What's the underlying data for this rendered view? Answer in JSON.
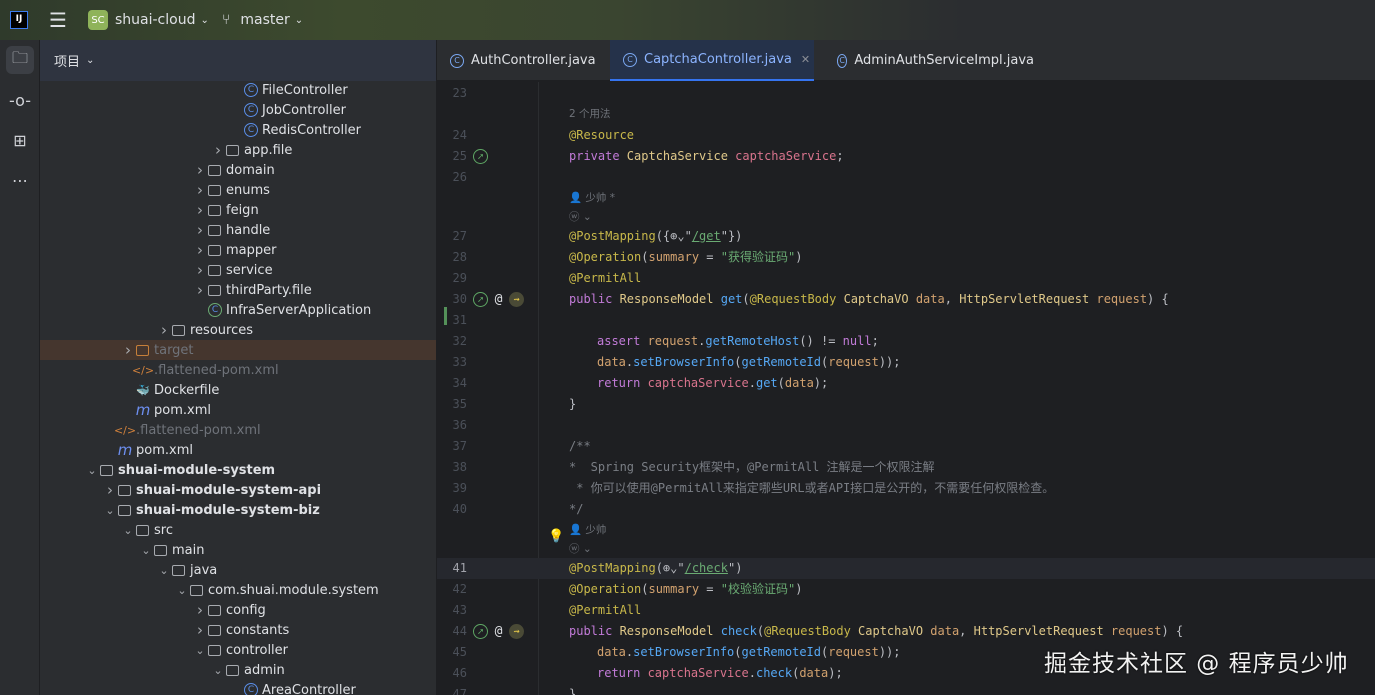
{
  "titlebar": {
    "logo": "IJ",
    "project_badge": "SC",
    "project_name": "shuai-cloud",
    "branch": "master",
    "brand_color": "#8fb35a"
  },
  "sidebar_tools": [
    {
      "icon": "folder-icon",
      "active": true
    },
    {
      "icon": "commit-icon"
    },
    {
      "icon": "structure-icon"
    },
    {
      "icon": "more-icon"
    }
  ],
  "project_panel": {
    "title": "项目",
    "items": [
      {
        "label": "FileController",
        "depth": 7,
        "type": "class"
      },
      {
        "label": "JobController",
        "depth": 7,
        "type": "class"
      },
      {
        "label": "RedisController",
        "depth": 7,
        "type": "class"
      },
      {
        "label": "app.file",
        "depth": 6,
        "type": "folder",
        "expanded": false
      },
      {
        "label": "domain",
        "depth": 5,
        "type": "folder",
        "expanded": false
      },
      {
        "label": "enums",
        "depth": 5,
        "type": "folder",
        "expanded": false
      },
      {
        "label": "feign",
        "depth": 5,
        "type": "folder",
        "expanded": false
      },
      {
        "label": "handle",
        "depth": 5,
        "type": "folder",
        "expanded": false
      },
      {
        "label": "mapper",
        "depth": 5,
        "type": "folder",
        "expanded": false
      },
      {
        "label": "service",
        "depth": 5,
        "type": "folder",
        "expanded": false
      },
      {
        "label": "thirdParty.file",
        "depth": 5,
        "type": "folder",
        "expanded": false
      },
      {
        "label": "InfraServerApplication",
        "depth": 5,
        "type": "spring"
      },
      {
        "label": "resources",
        "depth": 3,
        "type": "folder",
        "expanded": false
      },
      {
        "label": "target",
        "depth": 1,
        "type": "folder-excluded",
        "expanded": false,
        "muted": true,
        "selected": true
      },
      {
        "label": ".flattened-pom.xml",
        "depth": 1,
        "type": "xml",
        "muted": true
      },
      {
        "label": "Dockerfile",
        "depth": 1,
        "type": "docker"
      },
      {
        "label": "pom.xml",
        "depth": 1,
        "type": "maven"
      },
      {
        "label": ".flattened-pom.xml",
        "depth": 0,
        "type": "xml",
        "muted": true
      },
      {
        "label": "pom.xml",
        "depth": 0,
        "type": "maven"
      },
      {
        "label": "shuai-module-system",
        "depth": -1,
        "type": "module",
        "expanded": true,
        "bold": true
      },
      {
        "label": "shuai-module-system-api",
        "depth": 0,
        "type": "module",
        "expanded": false,
        "bold": true
      },
      {
        "label": "shuai-module-system-biz",
        "depth": 0,
        "type": "module",
        "expanded": true,
        "bold": true
      },
      {
        "label": "src",
        "depth": 1,
        "type": "folder",
        "expanded": true
      },
      {
        "label": "main",
        "depth": 2,
        "type": "folder",
        "expanded": true
      },
      {
        "label": "java",
        "depth": 3,
        "type": "folder",
        "expanded": true
      },
      {
        "label": "com.shuai.module.system",
        "depth": 4,
        "type": "folder",
        "expanded": true
      },
      {
        "label": "config",
        "depth": 5,
        "type": "folder",
        "expanded": false
      },
      {
        "label": "constants",
        "depth": 5,
        "type": "folder",
        "expanded": false
      },
      {
        "label": "controller",
        "depth": 5,
        "type": "folder",
        "expanded": true
      },
      {
        "label": "admin",
        "depth": 6,
        "type": "folder",
        "expanded": true
      },
      {
        "label": "AreaController",
        "depth": 7,
        "type": "class"
      }
    ]
  },
  "tabs": [
    {
      "label": "AuthController.java"
    },
    {
      "label": "CaptchaController.java",
      "active": true
    },
    {
      "label": "AdminAuthServiceImpl.java"
    }
  ],
  "editor": {
    "rows": [
      {
        "n": "23",
        "t": []
      },
      {
        "hint": "2 个用法"
      },
      {
        "n": "24",
        "t": [
          [
            "an",
            "@Resource"
          ]
        ]
      },
      {
        "n": "25",
        "g": [
          "bean"
        ],
        "t": [
          [
            "kw",
            "private "
          ],
          [
            "ty",
            "CaptchaService "
          ],
          [
            "fd",
            "captchaService"
          ],
          [
            "",
            "; "
          ]
        ]
      },
      {
        "n": "26",
        "t": []
      },
      {
        "hint": "👤 少帅 *"
      },
      {
        "hint": "ⓦ ⌄"
      },
      {
        "n": "27",
        "t": [
          [
            "an",
            "@PostMapping"
          ],
          [
            "",
            "({⊕⌄\""
          ],
          [
            "ur",
            "/get"
          ],
          [
            "",
            "\"})"
          ]
        ]
      },
      {
        "n": "28",
        "t": [
          [
            "an",
            "@Operation"
          ],
          [
            "",
            "("
          ],
          [
            "pa",
            "summary"
          ],
          [
            "",
            " = "
          ],
          [
            "st",
            "\"获得验证码\""
          ],
          [
            "",
            ")"
          ]
        ]
      },
      {
        "n": "29",
        "t": [
          [
            "an",
            "@PermitAll"
          ]
        ]
      },
      {
        "n": "30",
        "g": [
          "bean",
          "@",
          "endpoint"
        ],
        "t": [
          [
            "kw",
            "public "
          ],
          [
            "ty",
            "ResponseModel "
          ],
          [
            "me",
            "get"
          ],
          [
            "",
            "("
          ],
          [
            "an",
            "@RequestBody "
          ],
          [
            "ty",
            "CaptchaVO "
          ],
          [
            "pa",
            "data"
          ],
          [
            "",
            ", "
          ],
          [
            "ty",
            "HttpServletRequest "
          ],
          [
            "pa",
            "request"
          ],
          [
            "",
            ") {"
          ]
        ]
      },
      {
        "n": "31",
        "t": []
      },
      {
        "n": "32",
        "i": 1,
        "t": [
          [
            "kw",
            "assert "
          ],
          [
            "pa",
            "request"
          ],
          [
            "",
            "."
          ],
          [
            "me",
            "getRemoteHost"
          ],
          [
            "",
            "() != "
          ],
          [
            "kw",
            "null"
          ],
          [
            "",
            ";"
          ]
        ]
      },
      {
        "n": "33",
        "i": 1,
        "t": [
          [
            "pa",
            "data"
          ],
          [
            "",
            "."
          ],
          [
            "me",
            "setBrowserInfo"
          ],
          [
            "",
            "("
          ],
          [
            "me",
            "getRemoteId"
          ],
          [
            "",
            "("
          ],
          [
            "pa",
            "request"
          ],
          [
            "",
            "));"
          ]
        ]
      },
      {
        "n": "34",
        "i": 1,
        "t": [
          [
            "kw",
            "return "
          ],
          [
            "fd",
            "captchaService"
          ],
          [
            "",
            "."
          ],
          [
            "me",
            "get"
          ],
          [
            "",
            "("
          ],
          [
            "pa",
            "data"
          ],
          [
            "",
            ");"
          ]
        ]
      },
      {
        "n": "35",
        "t": [
          [
            "",
            "}"
          ]
        ]
      },
      {
        "n": "36",
        "t": []
      },
      {
        "n": "37",
        "t": [
          [
            "cm",
            "/**"
          ]
        ]
      },
      {
        "n": "38",
        "t": [
          [
            "cm",
            "*  Spring Security框架中，@PermitAll 注解是一个权限注解"
          ]
        ]
      },
      {
        "n": "39",
        "t": [
          [
            "cm",
            " * 你可以使用@PermitAll来指定哪些URL或者API接口是公开的，不需要任何权限检查。"
          ]
        ]
      },
      {
        "n": "40",
        "t": [
          [
            "cm",
            "*/"
          ]
        ]
      },
      {
        "hint": "👤 少帅",
        "bulb": true
      },
      {
        "hint": "ⓦ ⌄"
      },
      {
        "n": "41",
        "hl": true,
        "t": [
          [
            "an",
            "@PostMapping"
          ],
          [
            "",
            "(⊕⌄\""
          ],
          [
            "ur",
            "/check"
          ],
          [
            "",
            "\")"
          ]
        ]
      },
      {
        "n": "42",
        "t": [
          [
            "an",
            "@Operation"
          ],
          [
            "",
            "("
          ],
          [
            "pa",
            "summary"
          ],
          [
            "",
            " = "
          ],
          [
            "st",
            "\"校验验证码\""
          ],
          [
            "",
            ")"
          ]
        ]
      },
      {
        "n": "43",
        "t": [
          [
            "an",
            "@PermitAll"
          ]
        ]
      },
      {
        "n": "44",
        "g": [
          "bean",
          "@",
          "endpoint"
        ],
        "t": [
          [
            "kw",
            "public "
          ],
          [
            "ty",
            "ResponseModel "
          ],
          [
            "me",
            "check"
          ],
          [
            "",
            "("
          ],
          [
            "an",
            "@RequestBody "
          ],
          [
            "ty",
            "CaptchaVO "
          ],
          [
            "pa",
            "data"
          ],
          [
            "",
            ", "
          ],
          [
            "ty",
            "HttpServletRequest "
          ],
          [
            "pa",
            "request"
          ],
          [
            "",
            ") {"
          ]
        ]
      },
      {
        "n": "45",
        "i": 1,
        "t": [
          [
            "pa",
            "data"
          ],
          [
            "",
            "."
          ],
          [
            "me",
            "setBrowserInfo"
          ],
          [
            "",
            "("
          ],
          [
            "me",
            "getRemoteId"
          ],
          [
            "",
            "("
          ],
          [
            "pa",
            "request"
          ],
          [
            "",
            "));"
          ]
        ]
      },
      {
        "n": "46",
        "i": 1,
        "t": [
          [
            "kw",
            "return "
          ],
          [
            "fd",
            "captchaService"
          ],
          [
            "",
            "."
          ],
          [
            "me",
            "check"
          ],
          [
            "",
            "("
          ],
          [
            "pa",
            "data"
          ],
          [
            "",
            ");"
          ]
        ]
      },
      {
        "n": "47",
        "t": [
          [
            "",
            "}"
          ]
        ]
      }
    ]
  },
  "watermark": "掘金技术社区 @ 程序员少帅"
}
